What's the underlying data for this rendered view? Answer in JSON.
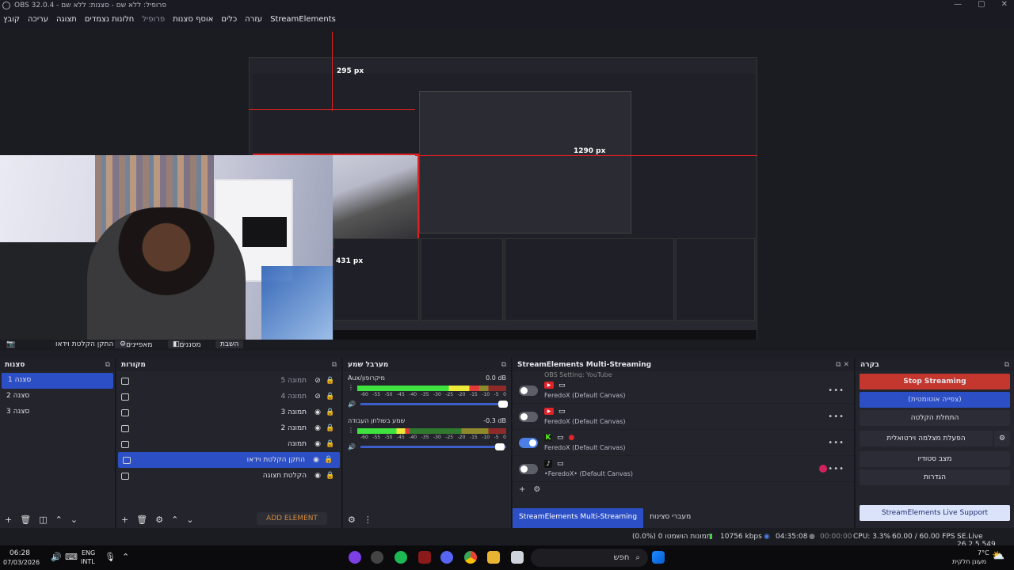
{
  "window": {
    "title": "OBS 32.0.4 - פרופיל: ללא שם - סצנות: ללא שם",
    "controls": [
      "—",
      "▢",
      "✕"
    ]
  },
  "menu": {
    "items": [
      "קובץ",
      "עריכה",
      "תצוגה",
      "חלונות נצמדים",
      "פרופיל",
      "אוסף סצנות",
      "כלים",
      "עזרה",
      "StreamElements"
    ]
  },
  "preview": {
    "measure_top": "295 px",
    "measure_right": "1290 px",
    "measure_left": "431 px"
  },
  "source_toolbar": {
    "source_name": "התקן הקלטת וידאו",
    "properties": "מאפיינים",
    "filters": "מסננים",
    "deactivate": "השבת"
  },
  "scenes": {
    "title": "סצנות",
    "items": [
      "סצנה 1",
      "סצנה 2",
      "סצנה 3"
    ]
  },
  "sources": {
    "title": "מקורות",
    "items": [
      "תמונה 5",
      "תמונה 4",
      "תמונה 3",
      "תמונה 2",
      "תמונה",
      "התקן הקלטת וידאו",
      "הקלטת תצוגה"
    ],
    "add_element": "ADD ELEMENT"
  },
  "mixer": {
    "title": "מערבל שמע",
    "channels": [
      {
        "name": "Aux/מיקרופון",
        "db": "0.0 dB",
        "level": 0.82
      },
      {
        "name": "שמע בשולחן העבודה",
        "db": "-0.3 dB",
        "level": 0.35
      }
    ],
    "scale": [
      "-60",
      "-55",
      "-50",
      "-45",
      "-40",
      "-35",
      "-30",
      "-25",
      "-20",
      "-15",
      "-10",
      "-5",
      "0"
    ]
  },
  "multistream": {
    "title": "StreamElements Multi-Streaming",
    "partial": "OBS Setting: YouTube",
    "rows": [
      {
        "platform": "YT",
        "label": "FeredoX (Default Canvas)",
        "on": false
      },
      {
        "platform": "YT",
        "label": "FeredoX (Default Canvas)",
        "on": false
      },
      {
        "platform": "K",
        "label": "FeredoX (Default Canvas)",
        "on": true
      },
      {
        "platform": "♪",
        "label": "•FeredoX• (Default Canvas)",
        "on": false
      }
    ],
    "tab_active": "StreamElements Multi-Streaming",
    "tab_other": "מעברי סצינות"
  },
  "controls": {
    "title": "בקרה",
    "stop_streaming": "Stop Streaming",
    "auto_mode": "(צפייה אוטומטית)",
    "start_recording": "התחלת הקלטה",
    "virtual_cam": "הפעלת מצלמה וירטואלית",
    "studio_mode": "מצב סטודיו",
    "settings": "הגדרות",
    "support": "StreamElements Live Support"
  },
  "status": {
    "frames": "(0.0%) 0 תמונות הושמטו",
    "bitrate": "10756 kbps",
    "stream_time": "04:35:08",
    "rec_time": "00:00:00",
    "cpu": "CPU: 3.3%",
    "fps": "60.00 / 60.00 FPS",
    "version": "SE.Live 26.2.5.549"
  },
  "taskbar": {
    "time": "06:28",
    "date": "07/03/2026",
    "lang1": "ENG",
    "lang2": "INTL",
    "search": "חפש",
    "weather_temp": "7°C",
    "weather_text": "מעונן חלקית"
  },
  "colors": {
    "accent": "#2c4fc6",
    "stop": "#c3372f",
    "measure": "#e02020"
  }
}
